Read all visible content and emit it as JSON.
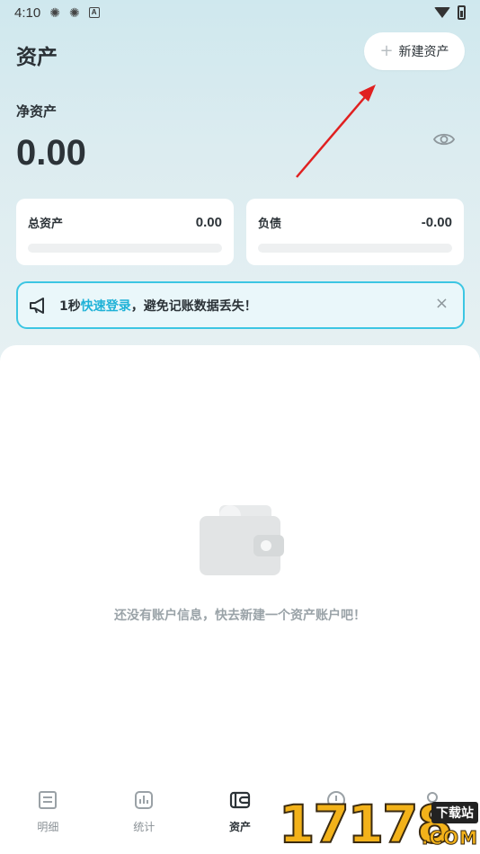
{
  "status_bar": {
    "time": "4:10",
    "badge": "A"
  },
  "header": {
    "title": "资产",
    "new_button_label": "新建资产"
  },
  "net_assets": {
    "label": "净资产",
    "value": "0.00"
  },
  "cards": {
    "total": {
      "label": "总资产",
      "value": "0.00"
    },
    "liability": {
      "label": "负债",
      "value": "-0.00"
    }
  },
  "notice": {
    "prefix": "1秒",
    "link": "快速登录",
    "suffix": "，避免记账数据丢失！",
    "close": "×"
  },
  "empty_state": {
    "text": "还没有账户信息，快去新建一个资产账户吧！"
  },
  "tabs": [
    {
      "label": "明细",
      "icon": "detail-icon"
    },
    {
      "label": "统计",
      "icon": "chart-icon"
    },
    {
      "label": "资产",
      "icon": "wallet-icon",
      "active": true
    },
    {
      "label": "",
      "icon": "discover-icon"
    },
    {
      "label": "",
      "icon": "profile-icon"
    }
  ],
  "watermark": {
    "digits": "17178",
    "tag": "下载站",
    "domain": ".COM"
  },
  "colors": {
    "accent": "#1fb2d7",
    "notice_border": "#3cc6e3",
    "arrow": "#e02020"
  }
}
